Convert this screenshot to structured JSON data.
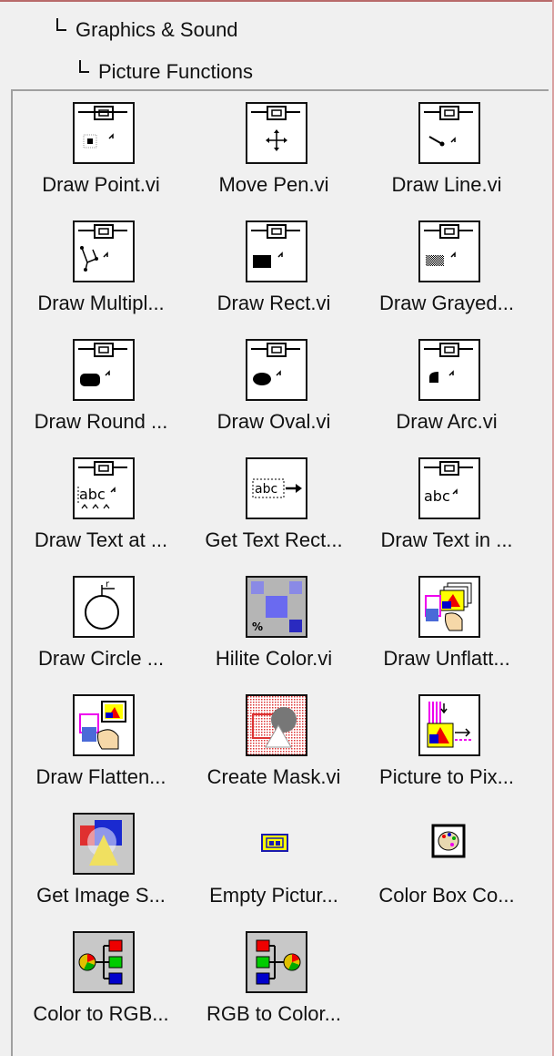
{
  "breadcrumb": {
    "level1": "Graphics & Sound",
    "level2": "Picture Functions"
  },
  "palette": {
    "items": [
      {
        "label": "Draw Point.vi",
        "icon": "draw-point-icon"
      },
      {
        "label": "Move Pen.vi",
        "icon": "move-pen-icon"
      },
      {
        "label": "Draw Line.vi",
        "icon": "draw-line-icon"
      },
      {
        "label": "Draw Multipl...",
        "icon": "draw-multiple-lines-icon"
      },
      {
        "label": "Draw Rect.vi",
        "icon": "draw-rect-icon"
      },
      {
        "label": "Draw Grayed...",
        "icon": "draw-grayed-rect-icon"
      },
      {
        "label": "Draw Round ...",
        "icon": "draw-round-rect-icon"
      },
      {
        "label": "Draw Oval.vi",
        "icon": "draw-oval-icon"
      },
      {
        "label": "Draw Arc.vi",
        "icon": "draw-arc-icon"
      },
      {
        "label": "Draw Text at ...",
        "icon": "draw-text-at-point-icon"
      },
      {
        "label": "Get Text Rect...",
        "icon": "get-text-rect-icon"
      },
      {
        "label": "Draw Text in ...",
        "icon": "draw-text-in-rect-icon"
      },
      {
        "label": "Draw Circle ...",
        "icon": "draw-circle-icon"
      },
      {
        "label": "Hilite Color.vi",
        "icon": "hilite-color-icon"
      },
      {
        "label": "Draw Unflatt...",
        "icon": "draw-unflattened-pixmap-icon"
      },
      {
        "label": "Draw Flatten...",
        "icon": "draw-flattened-pixmap-icon"
      },
      {
        "label": "Create Mask.vi",
        "icon": "create-mask-icon"
      },
      {
        "label": "Picture to Pix...",
        "icon": "picture-to-pixmap-icon"
      },
      {
        "label": "Get Image S...",
        "icon": "get-image-subset-icon"
      },
      {
        "label": "Empty Pictur...",
        "icon": "empty-picture-icon"
      },
      {
        "label": "Color Box Co...",
        "icon": "color-box-constant-icon"
      },
      {
        "label": "Color to RGB...",
        "icon": "color-to-rgb-icon"
      },
      {
        "label": "RGB to Color...",
        "icon": "rgb-to-color-icon"
      }
    ]
  }
}
